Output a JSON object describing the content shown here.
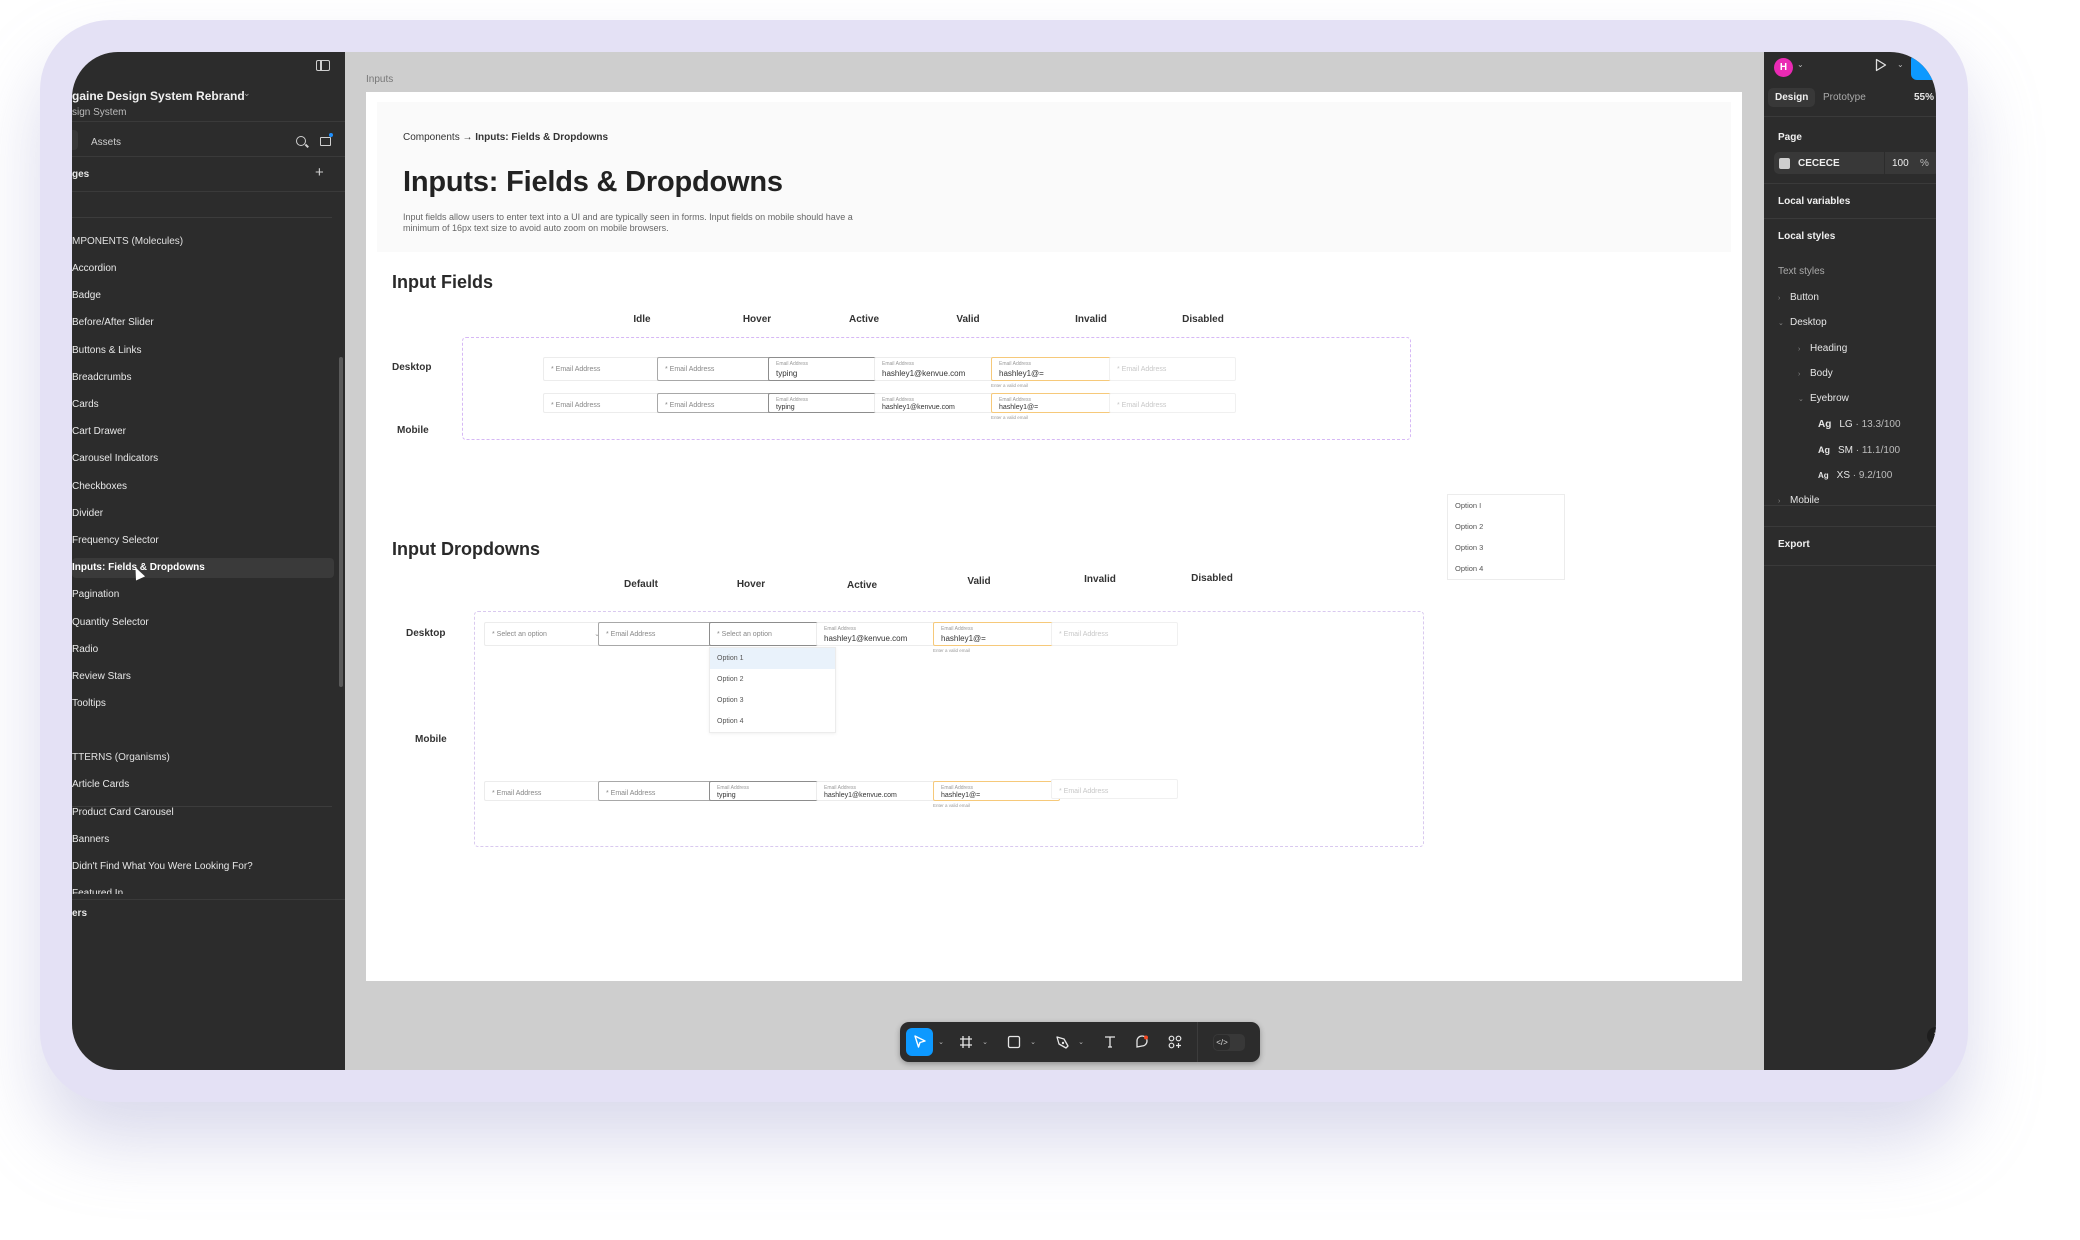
{
  "app": {
    "project_title": "gaine Design System Rebrand",
    "project_subtitle": "sign System",
    "assets_tab": "Assets",
    "pages_label": "ges",
    "layers_label": "ers"
  },
  "sidebar": {
    "sections": [
      {
        "heading": "MPONENTS (Molecules)",
        "items": [
          "Accordion",
          "Badge",
          "Before/After Slider",
          "Buttons & Links",
          "Breadcrumbs",
          "Cards",
          "Cart Drawer",
          "Carousel Indicators",
          "Checkboxes",
          "Divider",
          "Frequency Selector",
          "Inputs: Fields & Dropdowns",
          "Pagination",
          "Quantity Selector",
          "Radio",
          "Review Stars",
          "Tooltips"
        ]
      },
      {
        "heading": "TTERNS (Organisms)",
        "items": [
          "Article Cards",
          "Product Card Carousel",
          "Banners",
          "Didn't Find What You Were Looking For?",
          "Featured In"
        ]
      }
    ],
    "active_item": "Inputs: Fields & Dropdowns"
  },
  "canvas": {
    "frame_label": "Inputs",
    "breadcrumb": {
      "parent": "Components",
      "arrow": "→",
      "current": "Inputs: Fields & Dropdowns"
    },
    "title": "Inputs: Fields & Dropdowns",
    "description": "Input fields allow users to enter text into a UI and are typically seen in forms. Input fields on mobile should have a minimum of 16px text size to avoid auto zoom on mobile browsers.",
    "fields": {
      "heading": "Input Fields",
      "columns": [
        "Idle",
        "Hover",
        "Active",
        "Valid",
        "Invalid",
        "Disabled"
      ],
      "rows": [
        "Desktop",
        "Mobile"
      ],
      "placeholder": "* Email Address",
      "field_label": "Email Address",
      "active_value": "typing",
      "valid_value": "hashley1@kenvue.com",
      "invalid_value": "hashley1@=",
      "error_text": "Enter a valid email"
    },
    "dropdowns": {
      "heading": "Input Dropdowns",
      "columns": [
        "Default",
        "Hover",
        "Active",
        "Valid",
        "Invalid",
        "Disabled"
      ],
      "rows": [
        "Desktop",
        "Mobile"
      ],
      "select_placeholder": "* Select an option",
      "hover_placeholder": "* Email Address",
      "options": [
        "Option 1",
        "Option 2",
        "Option 3",
        "Option 4"
      ],
      "field_label": "Email Address",
      "active_value": "typing",
      "valid_value": "hashley1@kenvue.com",
      "invalid_value": "hashley1@=",
      "error_text": "Enter a valid email",
      "placeholder": "* Email Address"
    },
    "floating_menu": [
      "Option I",
      "Option 2",
      "Option 3",
      "Option 4"
    ]
  },
  "toolbar": {
    "tools": [
      "move-tool",
      "frame-tool",
      "rectangle-tool",
      "pen-tool",
      "text-tool",
      "comment-tool",
      "actions-tool"
    ],
    "dev_mode_icon": "</>"
  },
  "right_panel": {
    "avatar_initial": "H",
    "tab_design": "Design",
    "tab_prototype": "Prototype",
    "zoom": "55%",
    "page_section": "Page",
    "page_color": "CECECE",
    "page_opacity": "100",
    "percent_sign": "%",
    "local_variables": "Local variables",
    "local_styles": "Local styles",
    "text_styles_label": "Text styles",
    "tree": {
      "button": "Button",
      "desktop": "Desktop",
      "heading": "Heading",
      "body": "Body",
      "eyebrow": "Eyebrow",
      "styles": [
        {
          "ag": "Ag",
          "name": "LG",
          "meta": "· 13.3/100"
        },
        {
          "ag": "Ag",
          "name": "SM",
          "meta": "· 11.1/100"
        },
        {
          "ag": "Ag",
          "name": "XS",
          "meta": "· 9.2/100"
        }
      ],
      "mobile": "Mobile"
    },
    "export": "Export",
    "help": "?"
  }
}
